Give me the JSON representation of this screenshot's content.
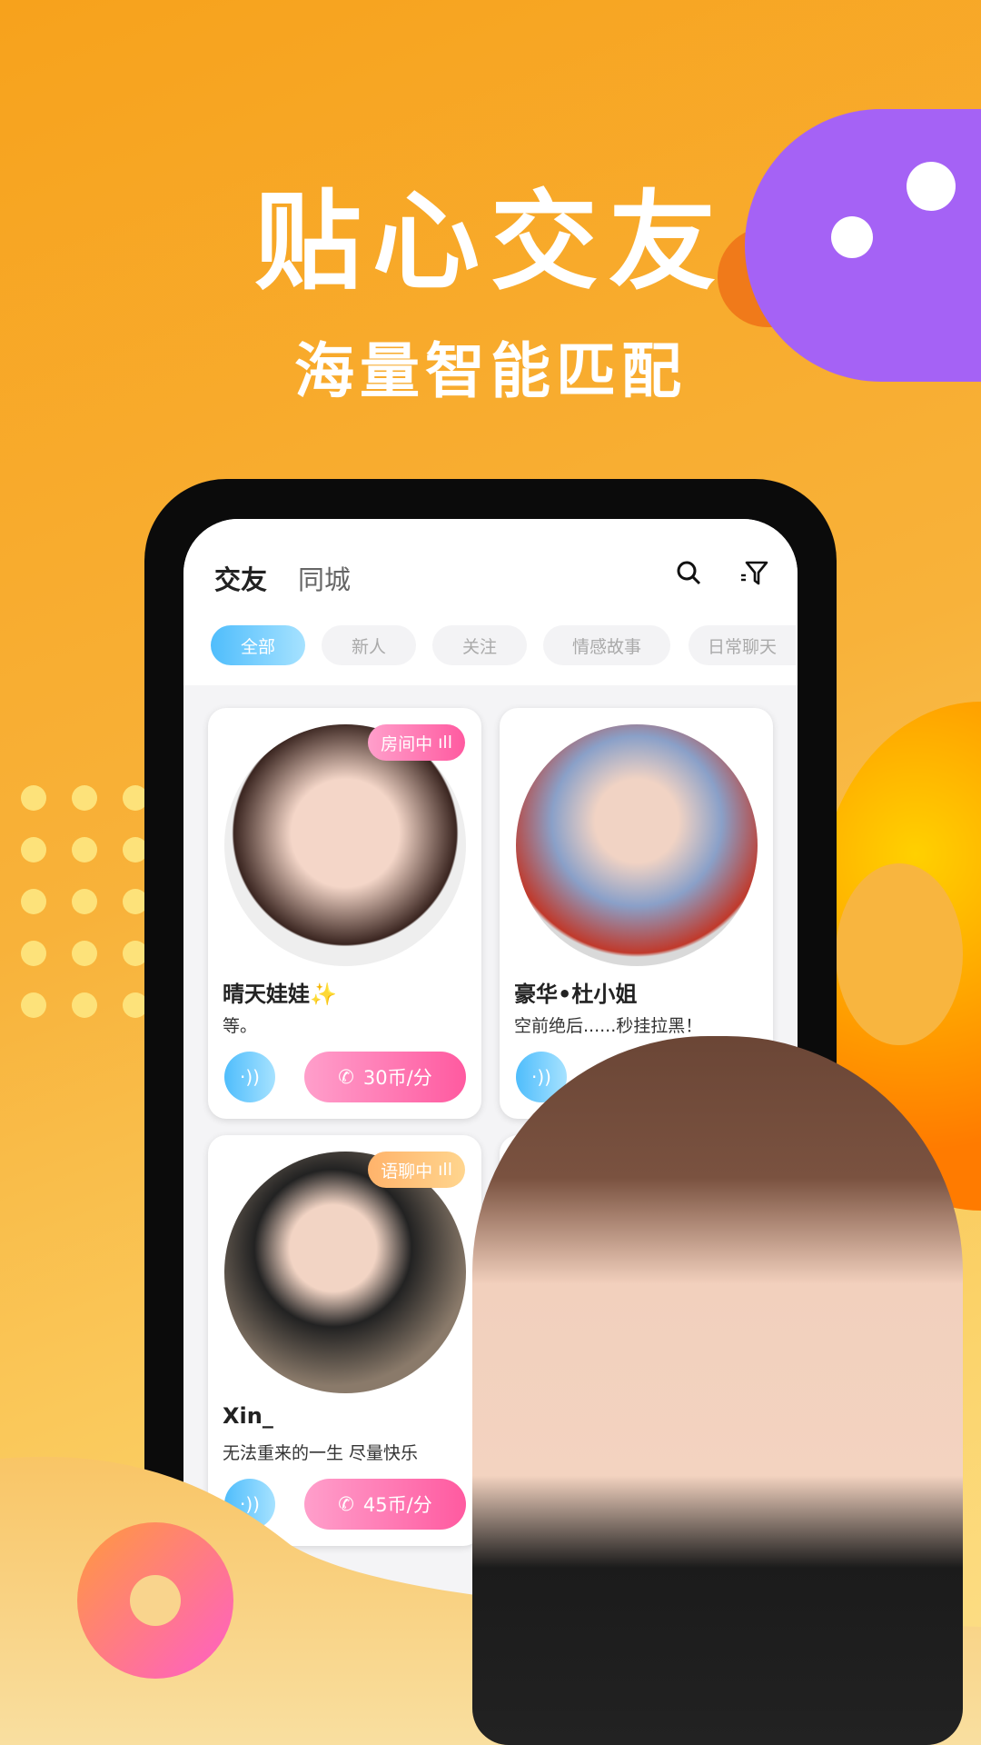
{
  "hero": {
    "title": "贴心交友",
    "subtitle": "海量智能匹配"
  },
  "colors": {
    "accent_blue": "#4fbdfc",
    "accent_pink": "#ff5aa0",
    "background": "#f7a21c",
    "planet": "#a562f5"
  },
  "app": {
    "tabs": [
      {
        "label": "交友",
        "active": true
      },
      {
        "label": "同城",
        "active": false
      }
    ],
    "icons": {
      "search": "search-icon",
      "filter": "filter-icon"
    },
    "chips": [
      {
        "label": "全部",
        "active": true
      },
      {
        "label": "新人"
      },
      {
        "label": "关注"
      },
      {
        "label": "情感故事"
      },
      {
        "label": "日常聊天"
      }
    ],
    "cards": [
      {
        "name": "晴天娃娃✨",
        "bio": "等。",
        "badge": "房间中",
        "price": "30币/分"
      },
      {
        "name": "豪华•杜小姐",
        "bio": "空前绝后......秒挂拉黑！",
        "badge": "",
        "price": ""
      },
      {
        "name": "Xin_",
        "bio": "无法重来的一生  尽量快乐",
        "badge": "语聊中",
        "price": "45币/分"
      }
    ]
  }
}
